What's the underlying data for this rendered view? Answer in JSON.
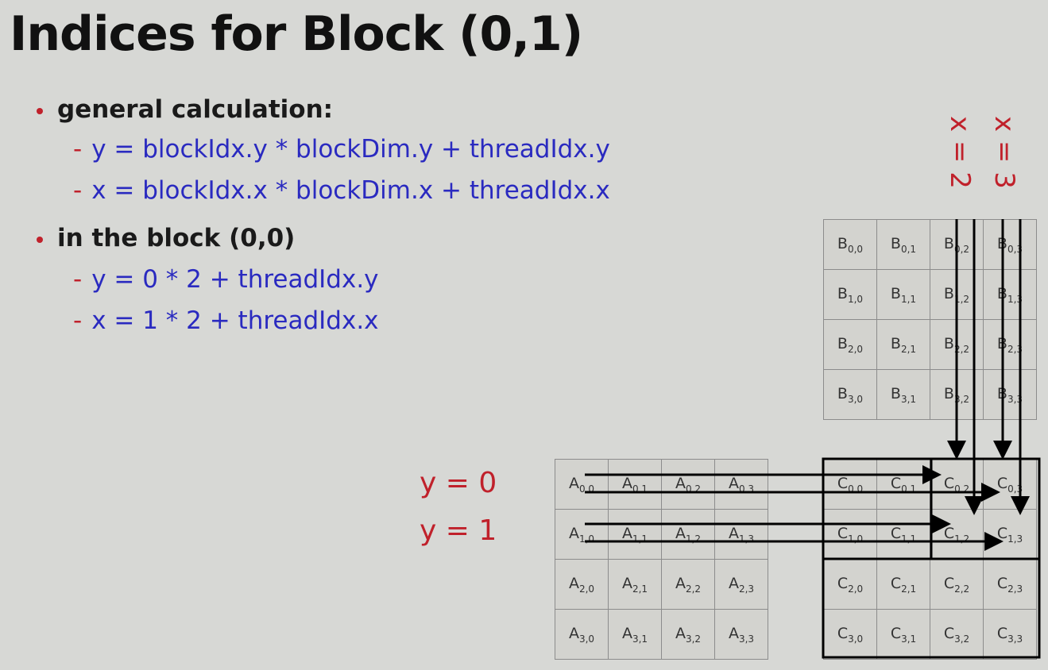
{
  "title": "Indices for Block (0,1)",
  "bullets": [
    {
      "heading": "general calculation:",
      "items": [
        "y = blockIdx.y * blockDim.y + threadIdx.y",
        "x = blockIdx.x * blockDim.x + threadIdx.x"
      ]
    },
    {
      "heading": "in the block (0,0)",
      "items": [
        "y = 0 * 2 + threadIdx.y",
        "x = 1 * 2 + threadIdx.x"
      ]
    }
  ],
  "dash": "-",
  "labels": {
    "y0": "y = 0",
    "y1": "y = 1",
    "x2": "x = 2",
    "x3": "x = 3"
  },
  "matrices": {
    "A": "A",
    "B": "B",
    "C": "C",
    "rows": 4,
    "cols": 4
  },
  "colors": {
    "accent_red": "#c0212b",
    "text_blue": "#2a2ac0",
    "background": "#d7d8d5"
  }
}
